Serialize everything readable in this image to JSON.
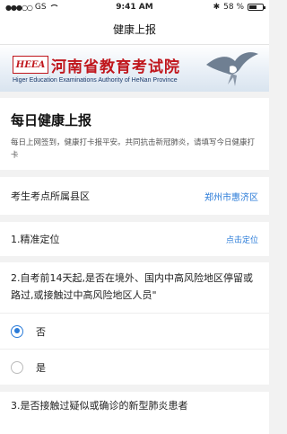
{
  "status_bar": {
    "signal": "●●●○○",
    "carrier": "GS",
    "time": "9:41 AM",
    "bluetooth": "✱",
    "battery_text": "58 %",
    "battery_level": 0.58
  },
  "nav": {
    "title": "健康上报"
  },
  "banner": {
    "logo_text": "HEEA",
    "title": "河南省教育考试院",
    "subtitle": "Higer Education Examinations Authority of HeNan Province"
  },
  "intro": {
    "title": "每日健康上报",
    "description": "每日上网签到，健康打卡报平安。共同抗击新冠肺炎，请填写今日健康打卡"
  },
  "district": {
    "label": "考生考点所属县区",
    "value": "郑州市惠济区"
  },
  "location": {
    "label": "1.精准定位",
    "action": "点击定位"
  },
  "q2": {
    "text": "2.自考前14天起,是否在境外、国内中高风险地区停留或路过,或接触过中高风险地区人员\"",
    "options": [
      {
        "label": "否",
        "checked": true
      },
      {
        "label": "是",
        "checked": false
      }
    ]
  },
  "q3": {
    "text": "3.是否接触过疑似或确诊的新型肺炎患者"
  },
  "colors": {
    "accent": "#2a7bd8",
    "brand_red": "#c0161c"
  }
}
